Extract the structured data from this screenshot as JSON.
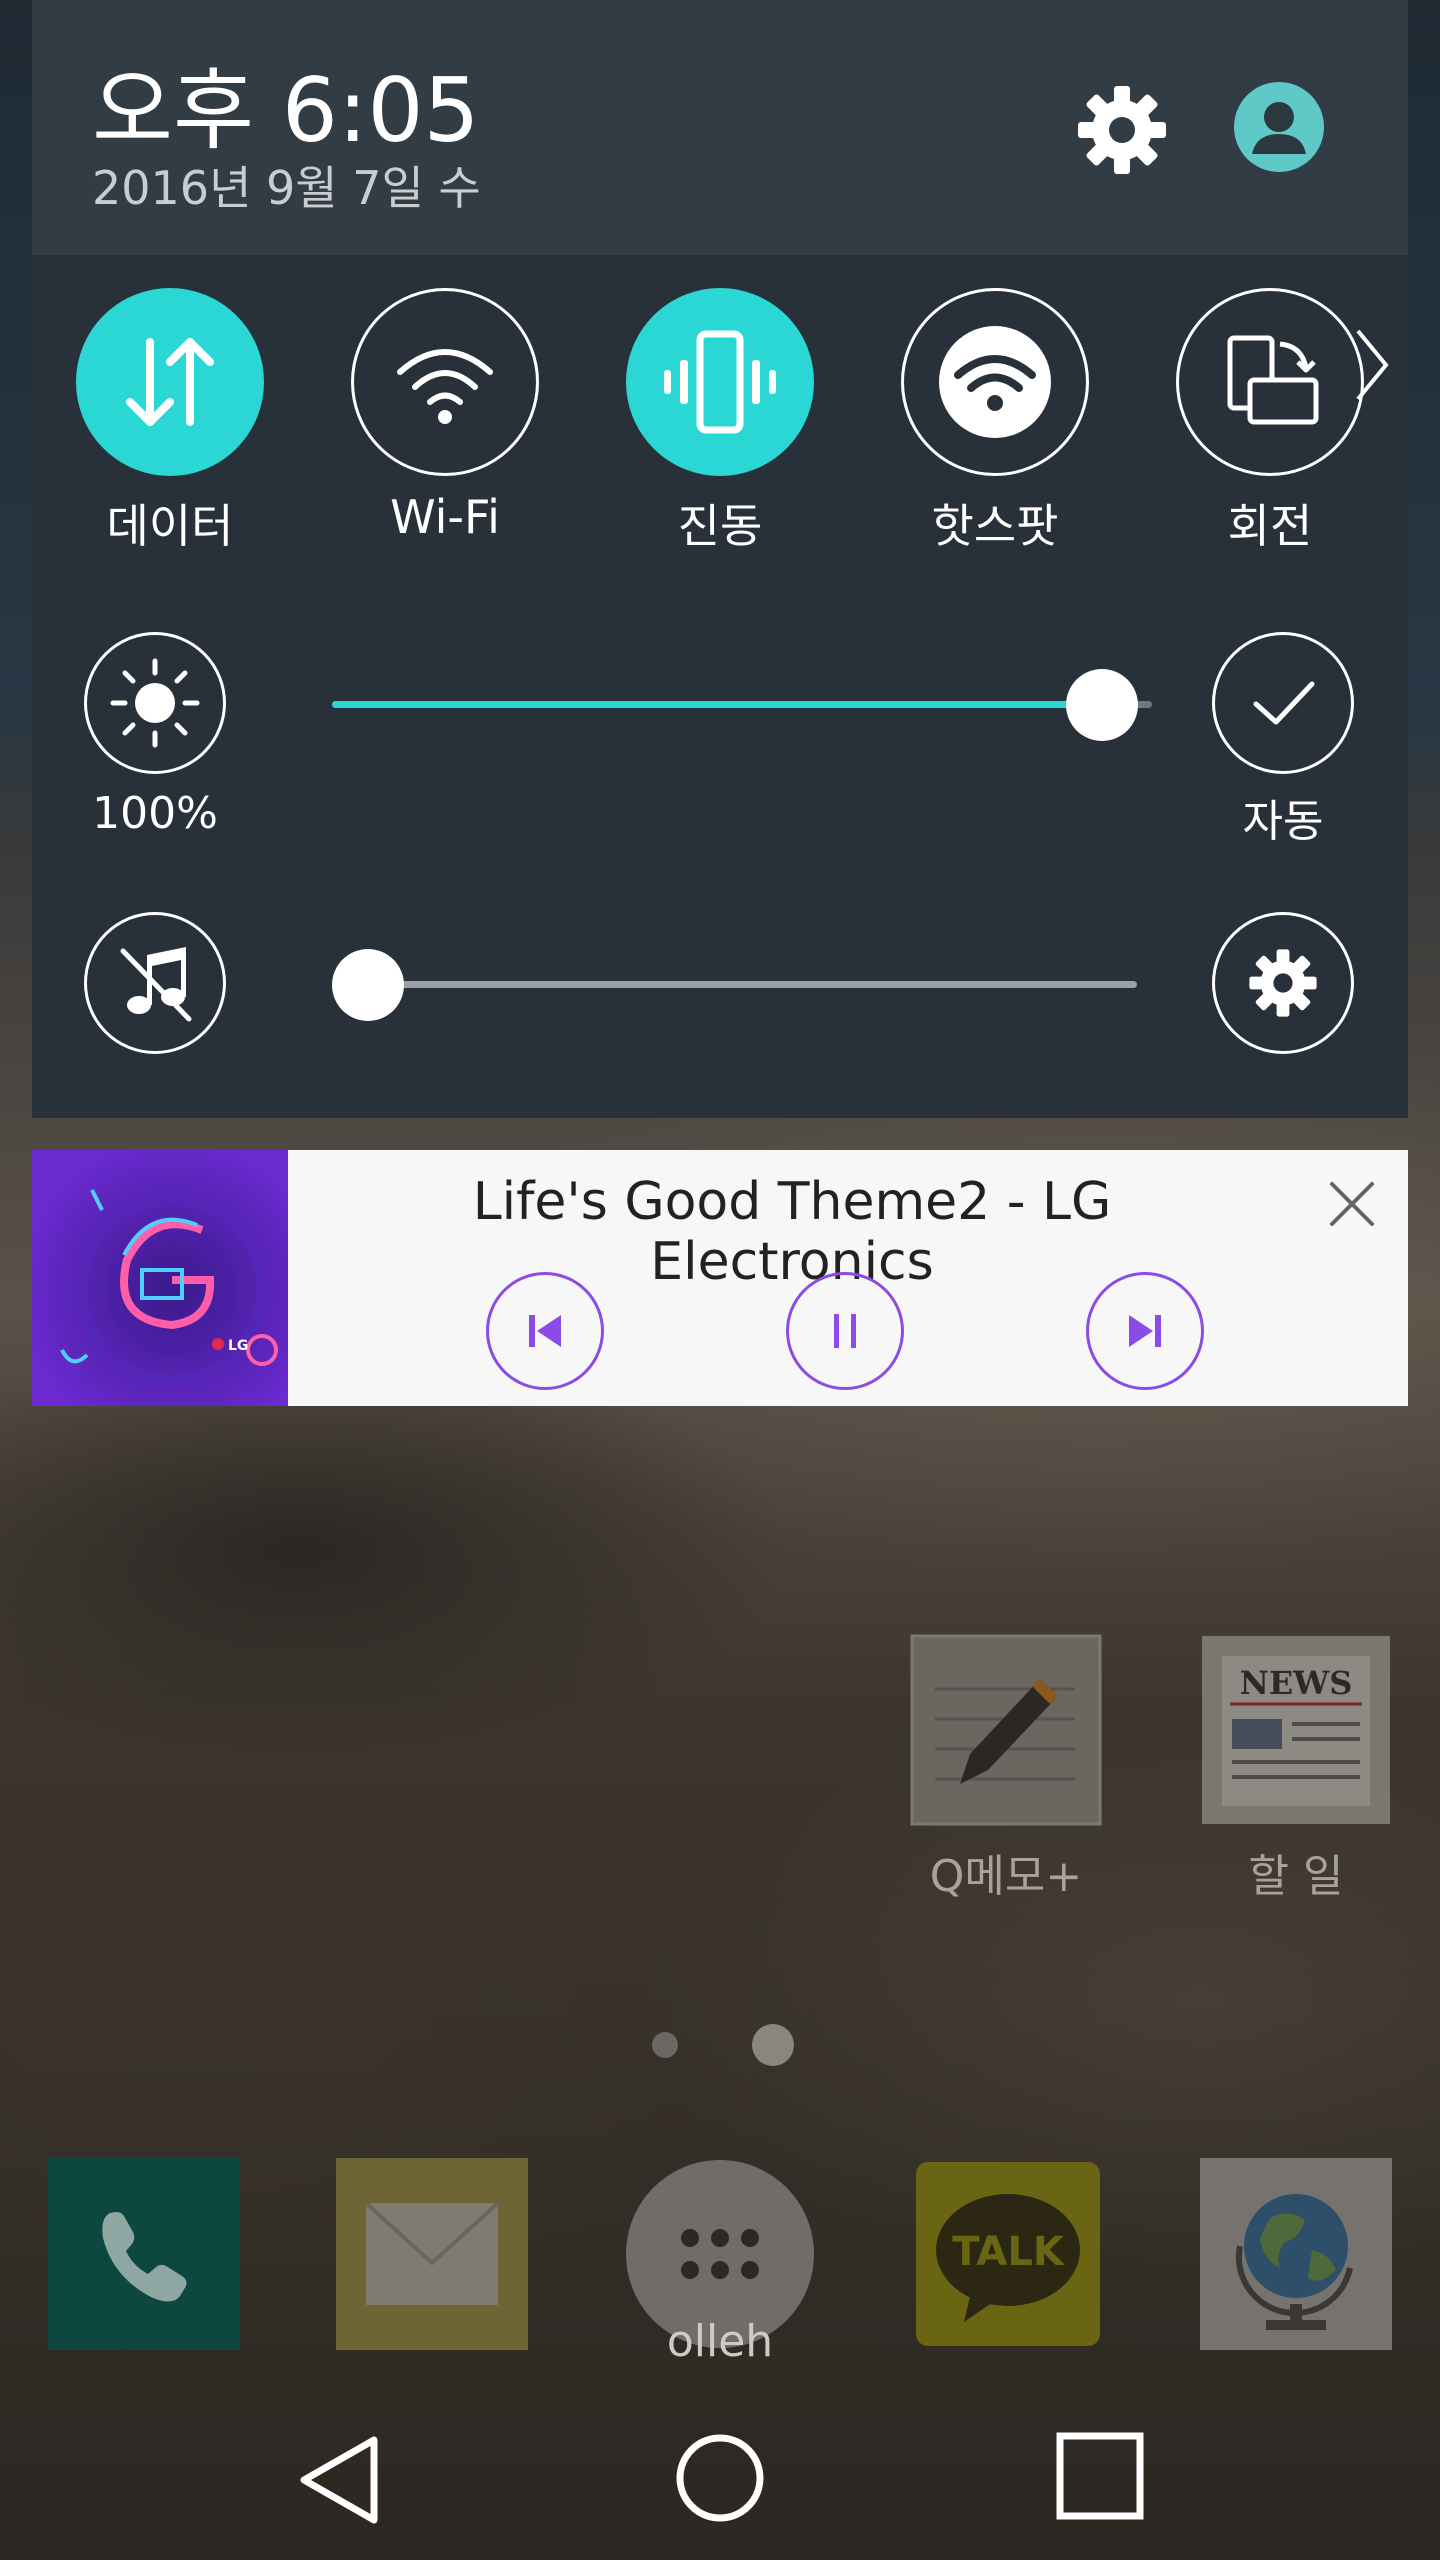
{
  "status": {
    "time": "오후 6:05",
    "date": "2016년 9월 7일 수"
  },
  "quick_settings": {
    "tiles": [
      {
        "label": "데이터",
        "icon": "data-transfer-icon",
        "active": true
      },
      {
        "label": "Wi-Fi",
        "icon": "wifi-icon",
        "active": false
      },
      {
        "label": "진동",
        "icon": "vibrate-icon",
        "active": true
      },
      {
        "label": "핫스팟",
        "icon": "hotspot-icon",
        "active": false
      },
      {
        "label": "회전",
        "icon": "rotate-icon",
        "active": false
      }
    ]
  },
  "brightness": {
    "value_label": "100%",
    "level": 1.0,
    "auto_label": "자동"
  },
  "volume": {
    "level": 0.0
  },
  "media": {
    "title": "Life's Good Theme2 - LG Electronics",
    "album_logo": "LG"
  },
  "home": {
    "apps": [
      {
        "label": "Q메모+",
        "icon": "memo-icon"
      },
      {
        "label": "할 일",
        "icon": "news-icon"
      }
    ],
    "news_icon_text": "NEWS",
    "dock": [
      {
        "label": "",
        "icon": "phone-icon"
      },
      {
        "label": "",
        "icon": "email-icon"
      },
      {
        "label": "olleh",
        "icon": "apps-drawer-icon"
      },
      {
        "label": "TALK",
        "icon": "kakaotalk-icon"
      },
      {
        "label": "",
        "icon": "browser-globe-icon"
      }
    ]
  },
  "colors": {
    "accent": "#2ad7d4",
    "panel": "#283139",
    "media_accent": "#8b4be6"
  }
}
